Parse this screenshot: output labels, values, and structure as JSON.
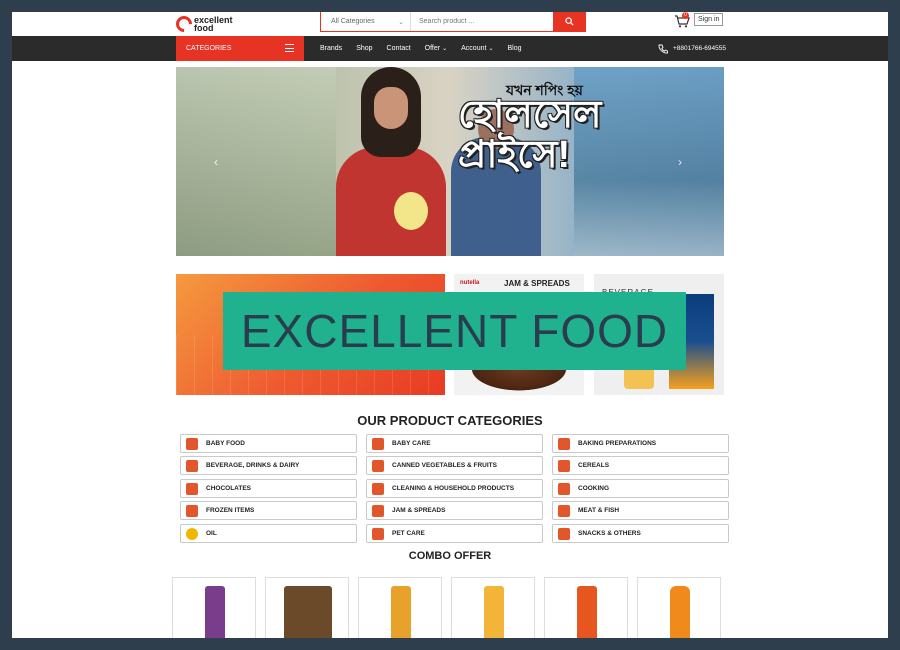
{
  "header": {
    "logo_line1": "excellent",
    "logo_line2": "food",
    "category_select": "All Categories",
    "search_placeholder": "Search product ...",
    "cart_count": "0",
    "signin_label": "Sign in"
  },
  "nav": {
    "categories_label": "CATEGORIES",
    "links": [
      "Brands",
      "Shop",
      "Contact",
      "Offer",
      "Account",
      "Blog"
    ],
    "phone": "+8801766-694555"
  },
  "hero": {
    "line1": "যখন শপিং হয়",
    "line2": "হোলসেল প্রাইসে!"
  },
  "promos": {
    "b_brand": "nutella",
    "b_title": "JAM & SPREADS",
    "c_title": "BEVERAGE"
  },
  "watermark": "EXCELLENT FOOD",
  "categories": {
    "title": "OUR PRODUCT CATEGORIES",
    "items": [
      "BABY FOOD",
      "BABY CARE",
      "BAKING PREPARATIONS",
      "BEVERAGE, DRINKS & DAIRY",
      "CANNED VEGETABLES & FRUITS",
      "CEREALS",
      "CHOCOLATES",
      "CLEANING & HOUSEHOLD PRODUCTS",
      "COOKING",
      "FROZEN ITEMS",
      "JAM & SPREADS",
      "MEAT & FISH",
      "OIL",
      "PET CARE",
      "SNACKS & OTHERS"
    ]
  },
  "combo": {
    "title": "COMBO OFFER",
    "colors": [
      "#7a3d8c",
      "#6b4a2a",
      "#e8a12a",
      "#f2b53a",
      "#e8561f",
      "#f08a1c"
    ]
  }
}
